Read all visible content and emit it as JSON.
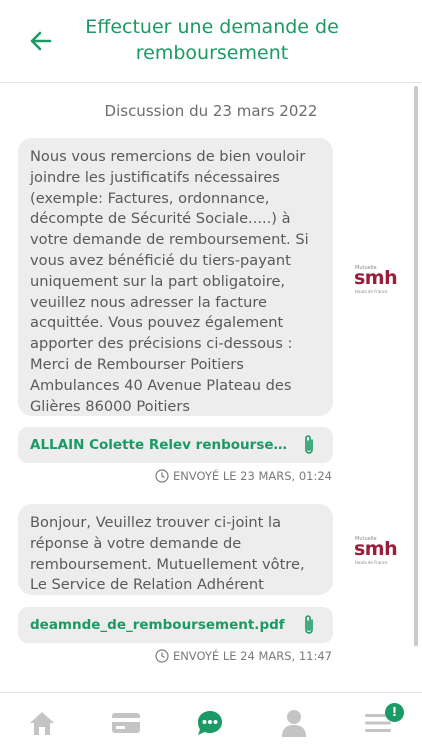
{
  "header": {
    "title": "Effectuer une demande de remboursement",
    "back_icon": "arrow-left-icon"
  },
  "discussion": {
    "date_label": "Discussion du 23 mars 2022",
    "messages": [
      {
        "text": "Nous vous remercions de bien vouloir joindre les justificatifs nécessaires (exemple: Factures, ordonnance, décompte de Sécurité Sociale.....) à votre demande de remboursement. Si vous avez bénéficié du tiers-payant uniquement sur la part obligatoire, veuillez nous adresser la facture acquittée. Vous pouvez également apporter des précisions ci-dessous : Merci de Rembourser Poitiers Ambulances 40 Avenue Plateau des Glières 86000 Poitiers",
        "attachment": "ALLAIN Colette Relev renboursement ...",
        "sent": "ENVOYÉ LE 23 MARS, 01:24"
      },
      {
        "text": "Bonjour, Veuillez trouver ci-joint la réponse à votre demande de remboursement. Mutuellement vôtre, Le Service de Relation Adhérent",
        "attachment": "deamnde_de_remboursement.pdf",
        "sent": "ENVOYÉ LE 24 MARS, 11:47"
      }
    ]
  },
  "logo": {
    "small_top": "Mutuelle",
    "brand": "smh",
    "small_bottom": "Hauts de France"
  },
  "tabbar": {
    "items": [
      "home-icon",
      "card-icon",
      "chat-icon",
      "user-icon",
      "menu-icon"
    ],
    "badge": "!"
  },
  "colors": {
    "accent": "#1a9a64",
    "brand": "#9b1d3c",
    "bubble": "#ededed"
  }
}
